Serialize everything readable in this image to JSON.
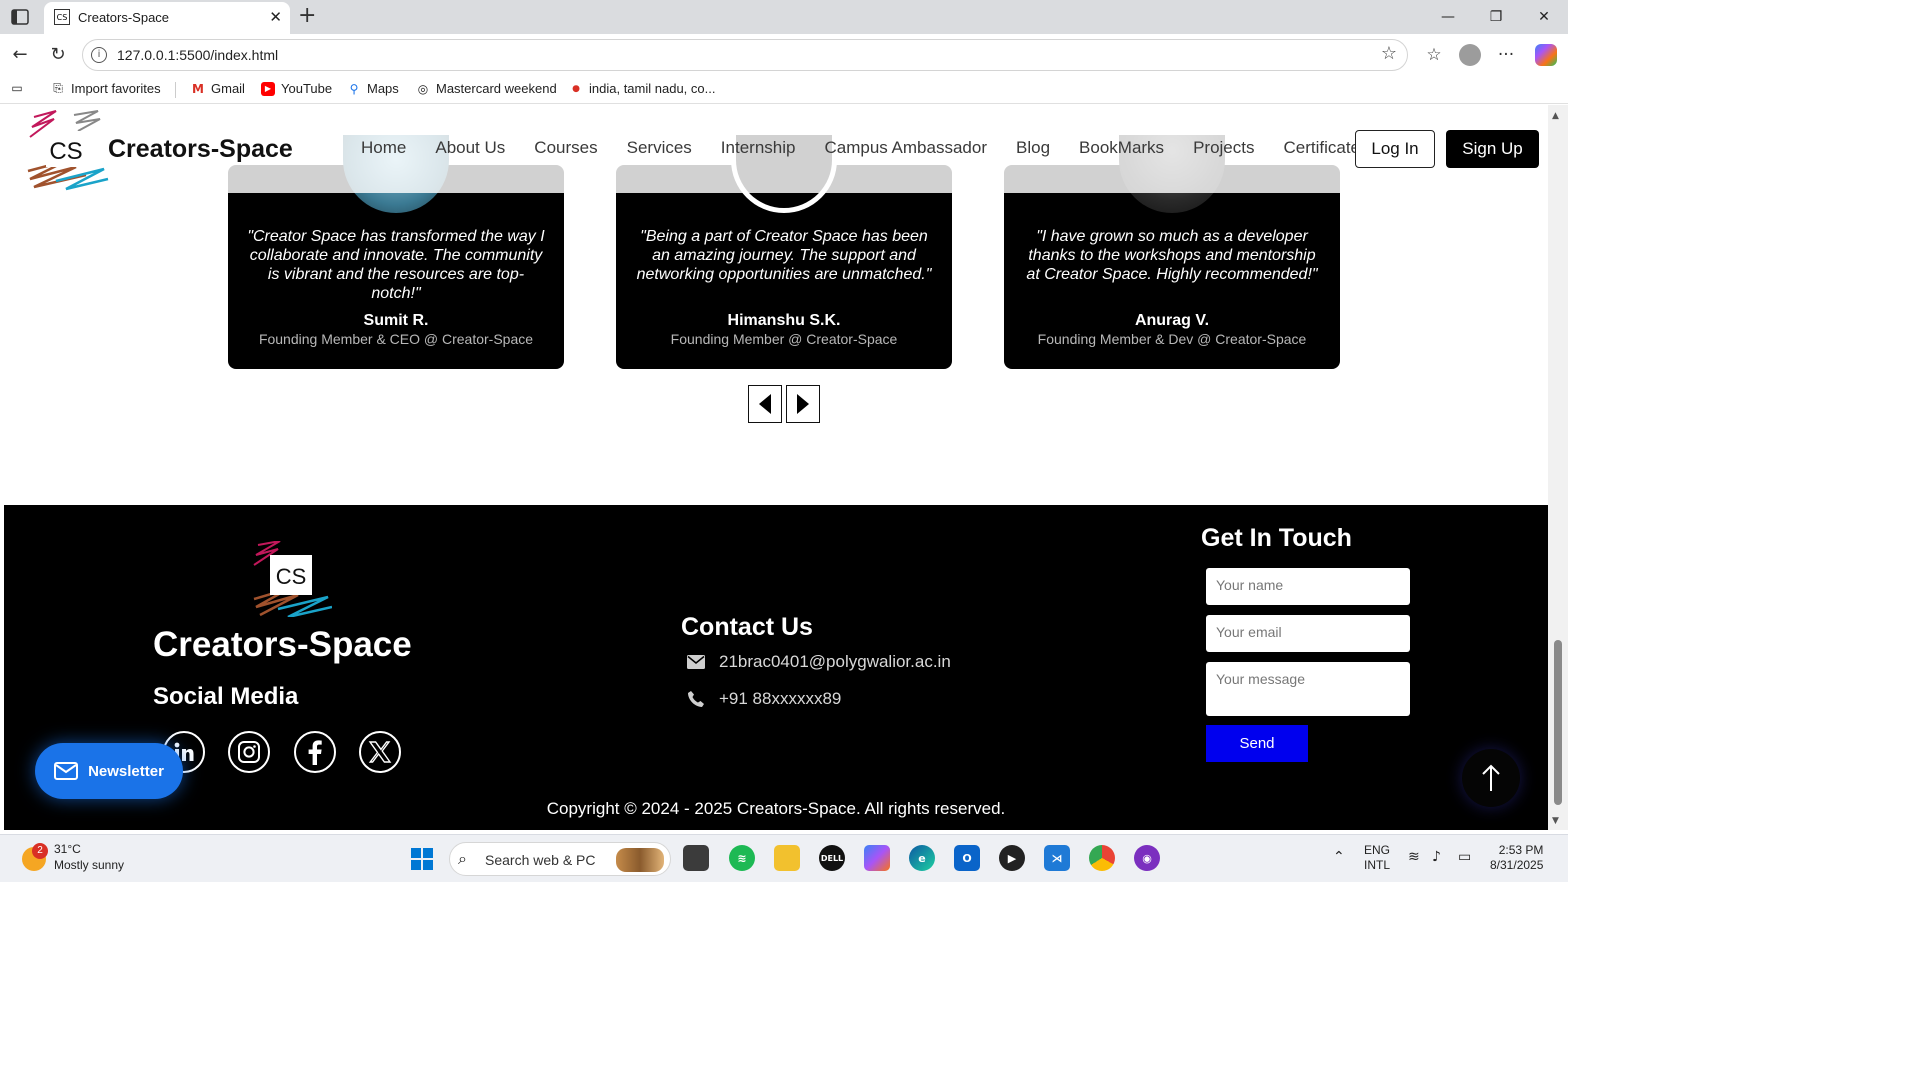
{
  "browser": {
    "tab_title": "Creators-Space",
    "url": "127.0.0.1:5500/index.html",
    "bookmarks": [
      "Import favorites",
      "Gmail",
      "YouTube",
      "Maps",
      "Mastercard weekend",
      "india, tamil nadu, co..."
    ]
  },
  "header": {
    "brand": "Creators-Space",
    "logo_text": "CS",
    "nav": [
      "Home",
      "About Us",
      "Courses",
      "Services",
      "Internship",
      "Campus Ambassador",
      "Blog",
      "BookMarks",
      "Projects",
      "Certificates"
    ],
    "login_label": "Log In",
    "signup_label": "Sign Up"
  },
  "testimonials": [
    {
      "quote": "\"Creator Space has transformed the way I collaborate and innovate. The community is vibrant and the resources are top-notch!\"",
      "name": "Sumit R.",
      "role": "Founding Member & CEO @ Creator-Space"
    },
    {
      "quote": "\"Being a part of Creator Space has been an amazing journey. The support and networking opportunities are unmatched.\"",
      "name": "Himanshu S.K.",
      "role": "Founding Member @ Creator-Space"
    },
    {
      "quote": "\"I have grown so much as a developer thanks to the workshops and mentorship at Creator Space. Highly recommended!\"",
      "name": "Anurag V.",
      "role": "Founding Member & Dev @ Creator-Space"
    }
  ],
  "footer": {
    "logo_text": "CS",
    "brand": "Creators-Space",
    "social_title": "Social Media",
    "newsletter_label": "Newsletter",
    "contact_title": "Contact Us",
    "email": "21brac0401@polygwalior.ac.in",
    "phone": "+91 88xxxxxx89",
    "get_in_touch_title": "Get In Touch",
    "name_placeholder": "Your name",
    "email_placeholder": "Your email",
    "message_placeholder": "Your message",
    "send_label": "Send",
    "copyright": "Copyright © 2024 - 2025 Creators-Space. All rights reserved."
  },
  "taskbar": {
    "weather_temp": "31°C",
    "weather_desc": "Mostly sunny",
    "weather_badge": "2",
    "search_placeholder": "Search web & PC",
    "lang_line1": "ENG",
    "lang_line2": "INTL",
    "time": "2:53 PM",
    "date": "8/31/2025"
  }
}
